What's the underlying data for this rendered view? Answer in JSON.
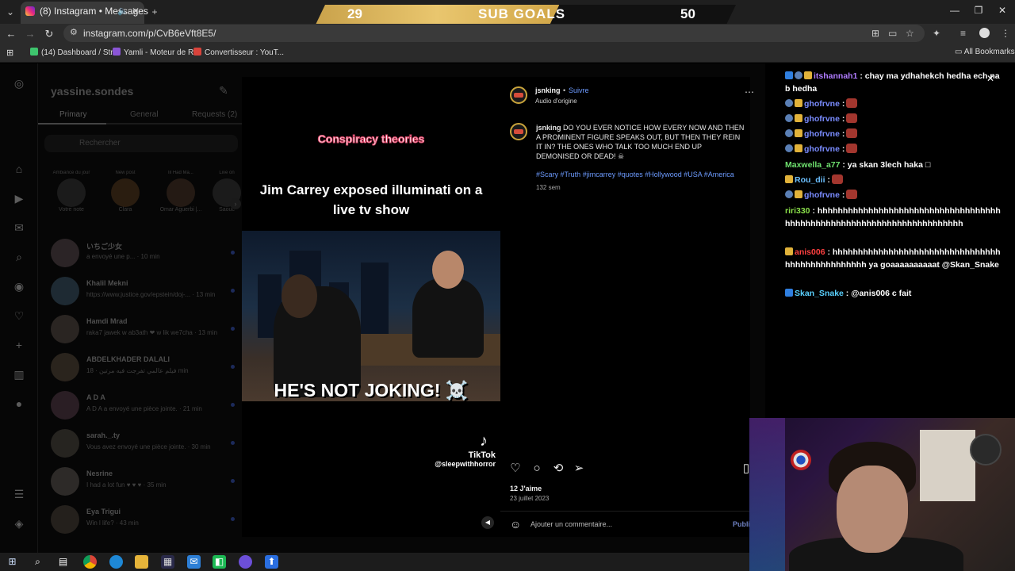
{
  "browser": {
    "tab_title": "(8) Instagram • Messages",
    "url": "instagram.com/p/CvB6eVft8E5/",
    "bookmarks": [
      "(14) Dashboard / Str...",
      "Yamli - Moteur de R...",
      "Convertisseur : YouT..."
    ],
    "all_bookmarks": "All Bookmarks"
  },
  "sub_goals": {
    "current": "29",
    "title": "SUB GOALS",
    "target": "50",
    "progress_fraction": 0.58,
    "accent": "#d9b257"
  },
  "dm": {
    "username": "yassine.sondes",
    "tabs": [
      "Primary",
      "General",
      "Requests (2)"
    ],
    "search_placeholder": "Rechercher",
    "notes": [
      {
        "bubble": "Ambiance du jour",
        "label": "Votre note"
      },
      {
        "bubble": "New post",
        "label": "Clara"
      },
      {
        "bubble": "lil Had Ma...",
        "label": "Omar Aguerbi |..."
      },
      {
        "bubble": "Live on",
        "label": "Saouc"
      }
    ],
    "conversations": [
      {
        "name": "いちご少女",
        "sub": "a envoyé une p...",
        "time": "10 min"
      },
      {
        "name": "Khalil Mekni",
        "sub": "https://www.justice.gov/epstein/doj-...",
        "time": "13 min"
      },
      {
        "name": "Hamdi Mrad",
        "sub": "raka7 jawek w ab3ath ❤ w lik we7cha",
        "time": "13 min"
      },
      {
        "name": "ABDELKHADER DALALI",
        "sub": "فيلم عالمي تفرجت فيه مرتين",
        "time": "18 min"
      },
      {
        "name": "A D A",
        "sub": "A D A a envoyé une pièce jointe.",
        "time": "21 min"
      },
      {
        "name": "sarah._.ty",
        "sub": "Vous avez envoyé une pièce jointe.",
        "time": "30 min"
      },
      {
        "name": "Nesrine",
        "sub": "I had a lot fun ♥ ♥ ♥",
        "time": "35 min"
      },
      {
        "name": "Eya Trigui",
        "sub": "Win l life?",
        "time": "43 min"
      }
    ]
  },
  "post": {
    "video_caption_top": "Conspiracy theories",
    "video_caption_main": "Jim Carrey exposed illuminati on a live tv show",
    "video_caption_bottom": "HE'S NOT JOKING! ☠️",
    "tiktok_label": "TikTok",
    "tiktok_handle": "@sleepwithhorror",
    "author": "jsnking",
    "follow_label": "Suivre",
    "audio": "Audio d'origine",
    "caption": "DO YOU EVER NOTICE HOW EVERY NOW AND THEN A PROMINENT FIGURE SPEAKS OUT, BUT THEN THEY REIN IT IN? THE ONES WHO TALK TOO MUCH END UP DEMONISED OR DEAD! ☠",
    "hashtags": "#Scary #Truth #jimcarrey #quotes #Hollywood #USA #America",
    "age": "132 sem",
    "likes": "12 J'aime",
    "date": "23 juillet 2023",
    "comment_placeholder": "Ajouter un commentaire...",
    "publish_label": "Publi"
  },
  "chat": [
    {
      "user": "itshannah1",
      "color": "#b07cff",
      "text": ": chay ma ydhahekch hedha ech nab hedha",
      "badges": [
        "blue",
        "grey",
        "gold"
      ]
    },
    {
      "user": "ghofrvne",
      "color": "#7a8cff",
      "text": ":",
      "badges": [
        "grey",
        "gold"
      ],
      "emote": true
    },
    {
      "user": "ghofrvne",
      "color": "#7a8cff",
      "text": ":",
      "badges": [
        "grey",
        "gold"
      ],
      "emote": true
    },
    {
      "user": "ghofrvne",
      "color": "#7a8cff",
      "text": ":",
      "badges": [
        "grey",
        "gold"
      ],
      "emote": true
    },
    {
      "user": "ghofrvne",
      "color": "#7a8cff",
      "text": ":",
      "badges": [
        "grey",
        "gold"
      ],
      "emote": true
    },
    {
      "user": "Maxwella_a77",
      "color": "#6ee06e",
      "text": ": ya skan 3lech haka □",
      "badges": []
    },
    {
      "user": "Rou_dii",
      "color": "#6cc0ff",
      "text": ":",
      "badges": [
        "gold"
      ],
      "emote": true
    },
    {
      "user": "ghofrvne",
      "color": "#7a8cff",
      "text": ":",
      "badges": [
        "grey",
        "gold"
      ],
      "emote": true
    },
    {
      "user": "riri330",
      "color": "#8be04a",
      "text": ": hhhhhhhhhhhhhhhhhhhhhhhhhhhhhhhhhhhhhhhhhhhhhhhhhhhhhhhhhhhhhhhhhhhhhhh",
      "badges": []
    },
    {
      "user": "anis006",
      "color": "#ff4040",
      "text": ": hhhhhhhhhhhhhhhhhhhhhhhhhhhhhhhhhhhhhhhhhhhhhhhhh ya goaaaaaaaaaat @Skan_Snake",
      "badges": [
        "gold"
      ]
    },
    {
      "user": "Skan_Snake",
      "color": "#5ad1ff",
      "text": ": @anis006 c fait",
      "badges": [
        "blue"
      ]
    }
  ]
}
